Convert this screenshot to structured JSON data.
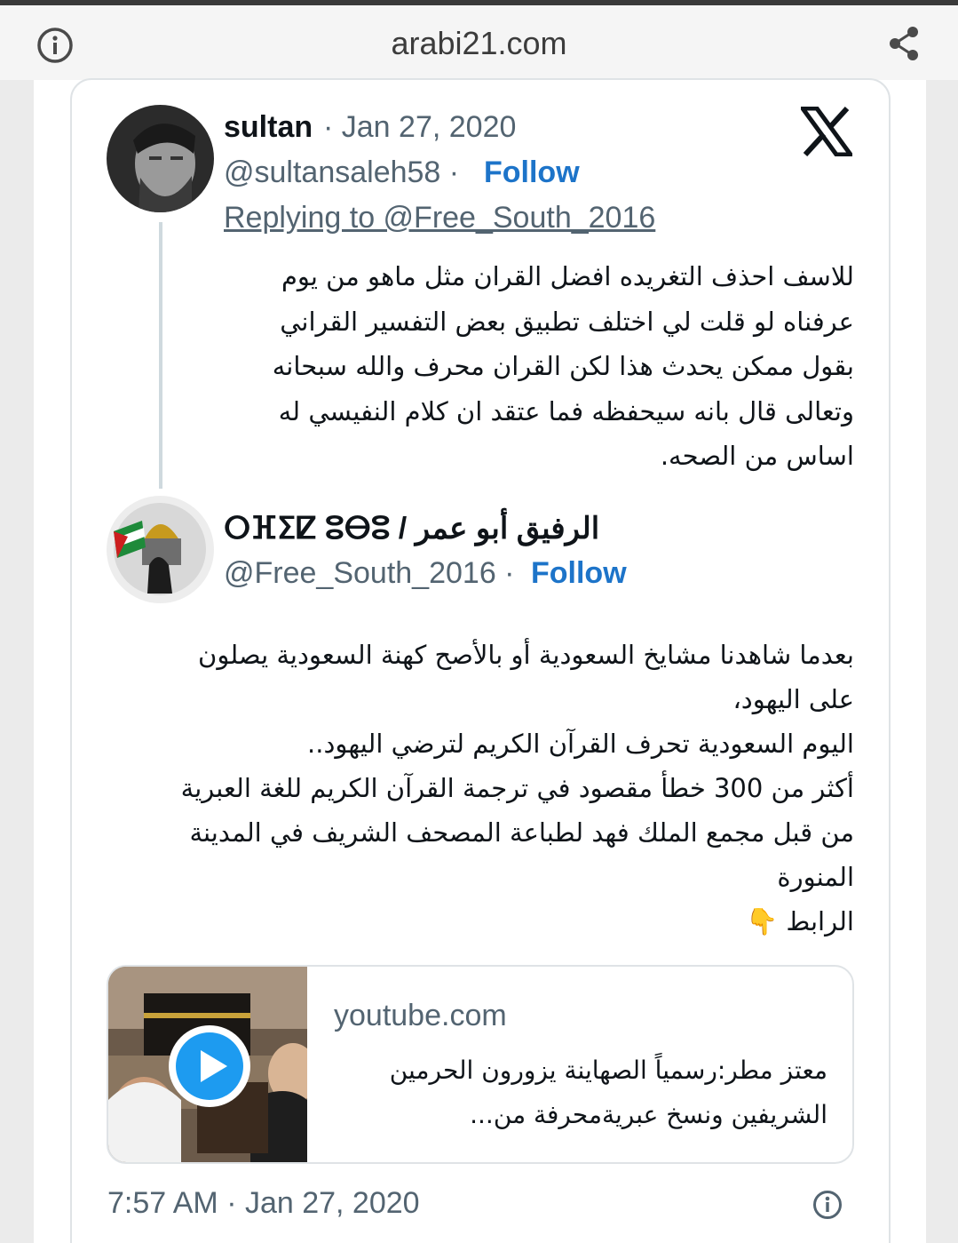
{
  "browser": {
    "url": "arabi21.com",
    "info_icon": "info-circle-icon",
    "share_icon": "share-icon"
  },
  "reply_tweet": {
    "name": "sultan",
    "date": "· Jan 27, 2020",
    "handle": "@sultansaleh58 ·",
    "follow": "Follow",
    "replying_to": "Replying to @Free_South_2016",
    "text": "للاسف احذف التغريده افضل القران مثل ماهو من يوم عرفناه لو قلت لي اختلف تطبيق بعض التفسير القراني بقول ممكن يحدث هذا لكن القران محرف والله سبحانه وتعالى قال بانه سيحفظه فما عتقد ان كلام النفيسي له اساس من الصحه."
  },
  "original_tweet": {
    "name": "ⵔⴼⵉⵇ ⵓⴱⵓ / الرفيق أبو عمر",
    "handle": "@Free_South_2016 ·",
    "follow": "Follow",
    "lines": [
      "بعدما شاهدنا مشايخ السعودية أو بالأصح كهنة السعودية يصلون",
      "على اليهود،",
      "اليوم السعودية تحرف القرآن الكريم لترضي اليهود..",
      "أكثر من 300 خطأ مقصود في ترجمة القرآن الكريم للغة العبرية",
      "من قبل مجمع الملك فهد لطباعة المصحف الشريف في المدينة",
      "المنورة",
      "الرابط 👇"
    ]
  },
  "link_card": {
    "domain": "youtube.com",
    "title": "معتز مطر:رسمياً الصهاينة يزورون الحرمين الشريفين ونسخ عبريةمحرفة من...",
    "play_icon": "play-icon"
  },
  "footer": {
    "timestamp": "7:57 AM · Jan 27, 2020",
    "info_icon": "info-circle-icon"
  },
  "colors": {
    "follow": "#1d74c9",
    "muted": "#536471",
    "text": "#0f1419",
    "border": "#dfe3e6",
    "play": "#1d9bf0"
  }
}
